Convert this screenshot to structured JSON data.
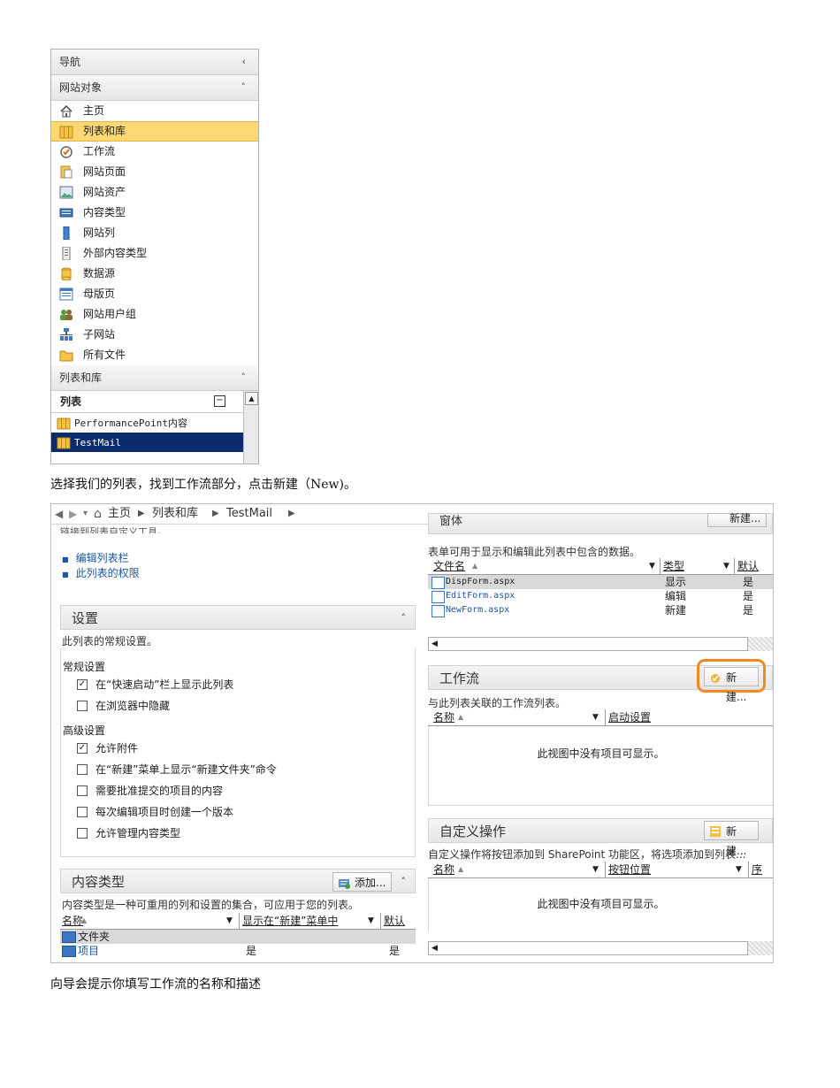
{
  "nav": {
    "header": "导航",
    "site_objects": {
      "title": "网站对象",
      "items": [
        {
          "label": "主页",
          "icon": "home-icon"
        },
        {
          "label": "列表和库",
          "icon": "list-library-icon"
        },
        {
          "label": "工作流",
          "icon": "workflow-icon"
        },
        {
          "label": "网站页面",
          "icon": "site-pages-icon"
        },
        {
          "label": "网站资产",
          "icon": "site-assets-icon"
        },
        {
          "label": "内容类型",
          "icon": "content-types-icon"
        },
        {
          "label": "网站列",
          "icon": "site-columns-icon"
        },
        {
          "label": "外部内容类型",
          "icon": "external-content-icon"
        },
        {
          "label": "数据源",
          "icon": "data-source-icon"
        },
        {
          "label": "母版页",
          "icon": "master-page-icon"
        },
        {
          "label": "网站用户组",
          "icon": "site-groups-icon"
        },
        {
          "label": "子网站",
          "icon": "subsites-icon"
        },
        {
          "label": "所有文件",
          "icon": "folder-icon"
        }
      ],
      "selected": "列表和库"
    },
    "lists_libraries": {
      "title": "列表和库",
      "section": "列表",
      "items": [
        "PerformancePoint内容",
        "TestMail"
      ],
      "selected": "TestMail"
    }
  },
  "caption1": "选择我们的列表，找到工作流部分，点击新建（New)。",
  "caption2": "向导会提示你填写工作流的名称和描述",
  "shot2": {
    "breadcrumb": [
      "主页",
      "列表和库",
      "TestMail"
    ],
    "top_cut_text": "链接到列表自定义工具。",
    "left_links": [
      "编辑列表栏",
      "此列表的权限"
    ],
    "settings": {
      "title": "设置",
      "desc": "此列表的常规设置。",
      "general_title": "常规设置",
      "general": [
        {
          "label": "在“快速启动”栏上显示此列表",
          "checked": true
        },
        {
          "label": "在浏览器中隐藏",
          "checked": false
        }
      ],
      "advanced_title": "高级设置",
      "advanced": [
        {
          "label": "允许附件",
          "checked": true
        },
        {
          "label": "在“新建”菜单上显示“新建文件夹”命令",
          "checked": false
        },
        {
          "label": "需要批准提交的项目的内容",
          "checked": false
        },
        {
          "label": "每次编辑项目时创建一个版本",
          "checked": false
        },
        {
          "label": "允许管理内容类型",
          "checked": false
        }
      ]
    },
    "content_types": {
      "title": "内容类型",
      "add_label": "添加...",
      "desc": "内容类型是一种可重用的列和设置的集合，可应用于您的列表。",
      "columns": [
        "名称",
        "显示在“新建”菜单中",
        "默认"
      ],
      "rows": [
        {
          "name": "文件夹",
          "show": "",
          "default": ""
        },
        {
          "name": "项目",
          "show": "是",
          "default": "是"
        }
      ]
    },
    "forms": {
      "title": "窗体",
      "new_label": "新建...",
      "desc": "表单可用于显示和编辑此列表中包含的数据。",
      "columns": [
        "文件名",
        "类型",
        "默认"
      ],
      "rows": [
        {
          "file": "DispForm.aspx",
          "type": "显示",
          "default": "是"
        },
        {
          "file": "EditForm.aspx",
          "type": "编辑",
          "default": "是"
        },
        {
          "file": "NewForm.aspx",
          "type": "新建",
          "default": "是"
        }
      ]
    },
    "workflows": {
      "title": "工作流",
      "new_label": "新建...",
      "desc": "与此列表关联的工作流列表。",
      "columns": [
        "名称",
        "启动设置"
      ],
      "empty": "此视图中没有项目可显示。",
      "highlight_color": "#f08a24"
    },
    "custom_actions": {
      "title": "自定义操作",
      "new_label": "新建...",
      "desc": "自定义操作将按钮添加到 SharePoint 功能区，将选项添加到列表...",
      "columns": [
        "名称",
        "按钮位置",
        "序"
      ],
      "empty": "此视图中没有项目可显示。"
    }
  }
}
